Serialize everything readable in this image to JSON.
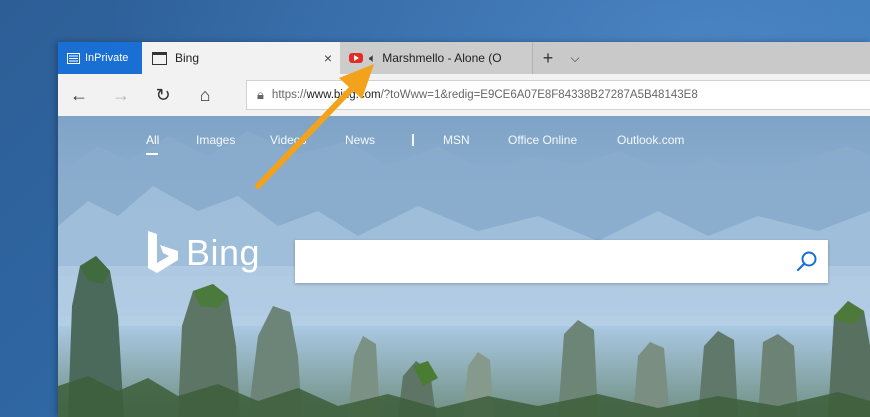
{
  "colors": {
    "inprivate_bg": "#1a6fd4",
    "arrow": "#f3a21b",
    "youtube_red": "#e52d27"
  },
  "tabs": {
    "inprivate_label": "InPrivate",
    "active": {
      "title": "Bing",
      "icon": "page-icon",
      "close": "×"
    },
    "inactive": {
      "title": "Marshmello - Alone (O",
      "icon": "youtube-icon",
      "audio_icon": "speaker-icon",
      "audio_glyph": "🔈︎"
    },
    "new_tab": "+",
    "tab_list": "⌵"
  },
  "nav": {
    "back": "←",
    "forward": "→",
    "refresh": "↻",
    "home": "⌂"
  },
  "address": {
    "lock": "🔒︎",
    "scheme": "https://",
    "domain": "www.bing.com",
    "rest": "/?toWww=1&redig=E9CE6A07E8F84338B27287A5B48143E8"
  },
  "bing": {
    "nav": [
      "All",
      "Images",
      "Videos",
      "News",
      "MSN",
      "Office Online",
      "Outlook.com"
    ],
    "logo_text": "Bing",
    "search_placeholder": ""
  }
}
